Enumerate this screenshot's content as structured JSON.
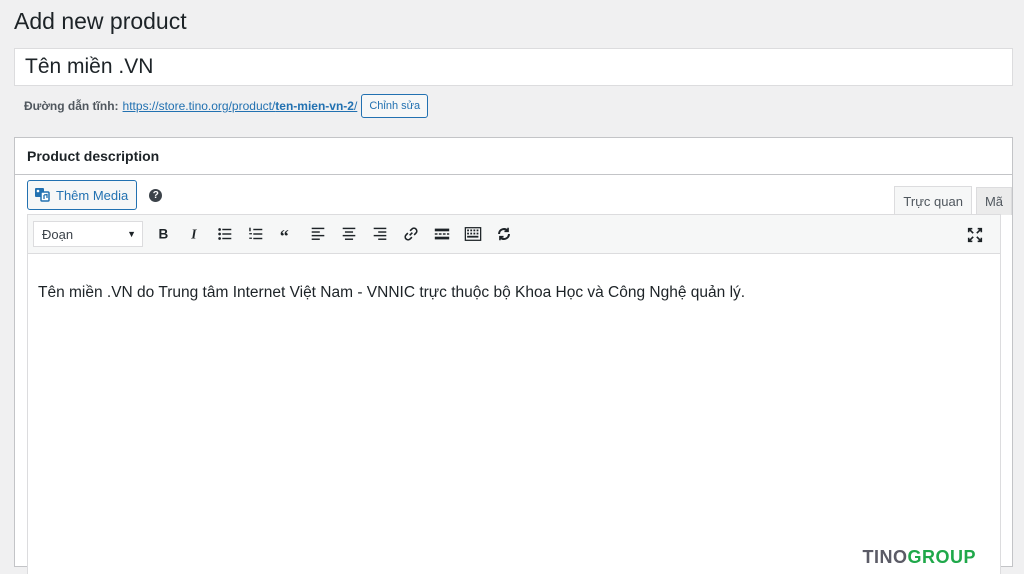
{
  "page": {
    "title": "Add new product"
  },
  "product": {
    "title_value": "Tên miền .VN"
  },
  "permalink": {
    "label": "Đường dẫn tĩnh:",
    "url_base": "https://store.tino.org/product/",
    "slug": "ten-mien-vn-2",
    "url_suffix": "/",
    "edit_label": "Chỉnh sửa"
  },
  "description_box": {
    "title": "Product description",
    "add_media_label": "Thêm Media",
    "help_glyph": "?",
    "tabs": [
      {
        "label": "Trực quan",
        "active": true
      },
      {
        "label": "Mã",
        "active": false
      }
    ],
    "format_select": {
      "value": "Đoạn"
    },
    "toolbar_icons": [
      "bold-icon",
      "italic-icon",
      "bulleted-list-icon",
      "numbered-list-icon",
      "blockquote-icon",
      "align-left-icon",
      "align-center-icon",
      "align-right-icon",
      "link-icon",
      "read-more-icon",
      "toolbar-toggle-icon",
      "wp-refresh-icon",
      "fullscreen-icon"
    ],
    "content": "Tên miền .VN do Trung tâm Internet Việt Nam - VNNIC trực thuộc bộ Khoa Học và Công Nghệ quản lý."
  },
  "watermark": {
    "part_a": "TINO",
    "part_b": "GROUP"
  },
  "colors": {
    "accent": "#2271b1",
    "background": "#f0f0f1",
    "watermark_green": "#1fa84a"
  }
}
